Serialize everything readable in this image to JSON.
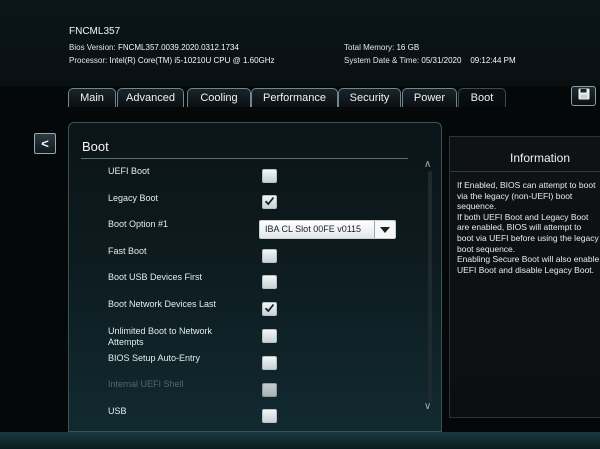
{
  "system": {
    "name": "FNCML357",
    "bios_version_label": "Bios Version:",
    "bios_version": "FNCML357.0039.2020.0312.1734",
    "processor_label": "Processor:",
    "processor": "Intel(R) Core(TM) i5-10210U CPU @ 1.60GHz",
    "total_memory_label": "Total Memory:",
    "total_memory": "16 GB",
    "datetime_label": "System Date & Time:",
    "date": "05/31/2020",
    "time": "09:12:44 PM"
  },
  "tabs": [
    {
      "label": "Main"
    },
    {
      "label": "Advanced"
    },
    {
      "label": "Cooling"
    },
    {
      "label": "Performance"
    },
    {
      "label": "Security"
    },
    {
      "label": "Power"
    },
    {
      "label": "Boot"
    }
  ],
  "active_tab": "Boot",
  "back_button": "<",
  "panel": {
    "title": "Boot",
    "options": [
      {
        "label": "UEFI Boot",
        "checked": false
      },
      {
        "label": "Legacy Boot",
        "checked": true
      },
      {
        "label": "Boot Option #1"
      },
      {
        "label": "Fast Boot",
        "checked": false
      },
      {
        "label": "Boot USB Devices First",
        "checked": false
      },
      {
        "label": "Boot Network Devices Last",
        "checked": true
      },
      {
        "label": "Unlimited Boot to Network Attempts",
        "checked": false
      },
      {
        "label": "BIOS Setup Auto-Entry",
        "checked": false
      },
      {
        "label": "Internal UEFI Shell",
        "checked": false,
        "disabled": true
      },
      {
        "label": "USB",
        "checked": false
      }
    ],
    "boot_option_1_value": "IBA CL Slot 00FE v0115"
  },
  "information": {
    "title": "Information",
    "text": "If Enabled, BIOS can attempt to boot\nvia the legacy (non-UEFI) boot\nsequence.\nIf both UEFI Boot and Legacy Boot\nare enabled, BIOS will attempt to\nboot via UEFI before using the legacy\nboot sequence.\nEnabling Secure Boot will also enable\nUEFI Boot and disable Legacy Boot."
  },
  "colors": {
    "background": "#050809",
    "panel_accent": "#112a30",
    "text": "#e8eef0"
  }
}
